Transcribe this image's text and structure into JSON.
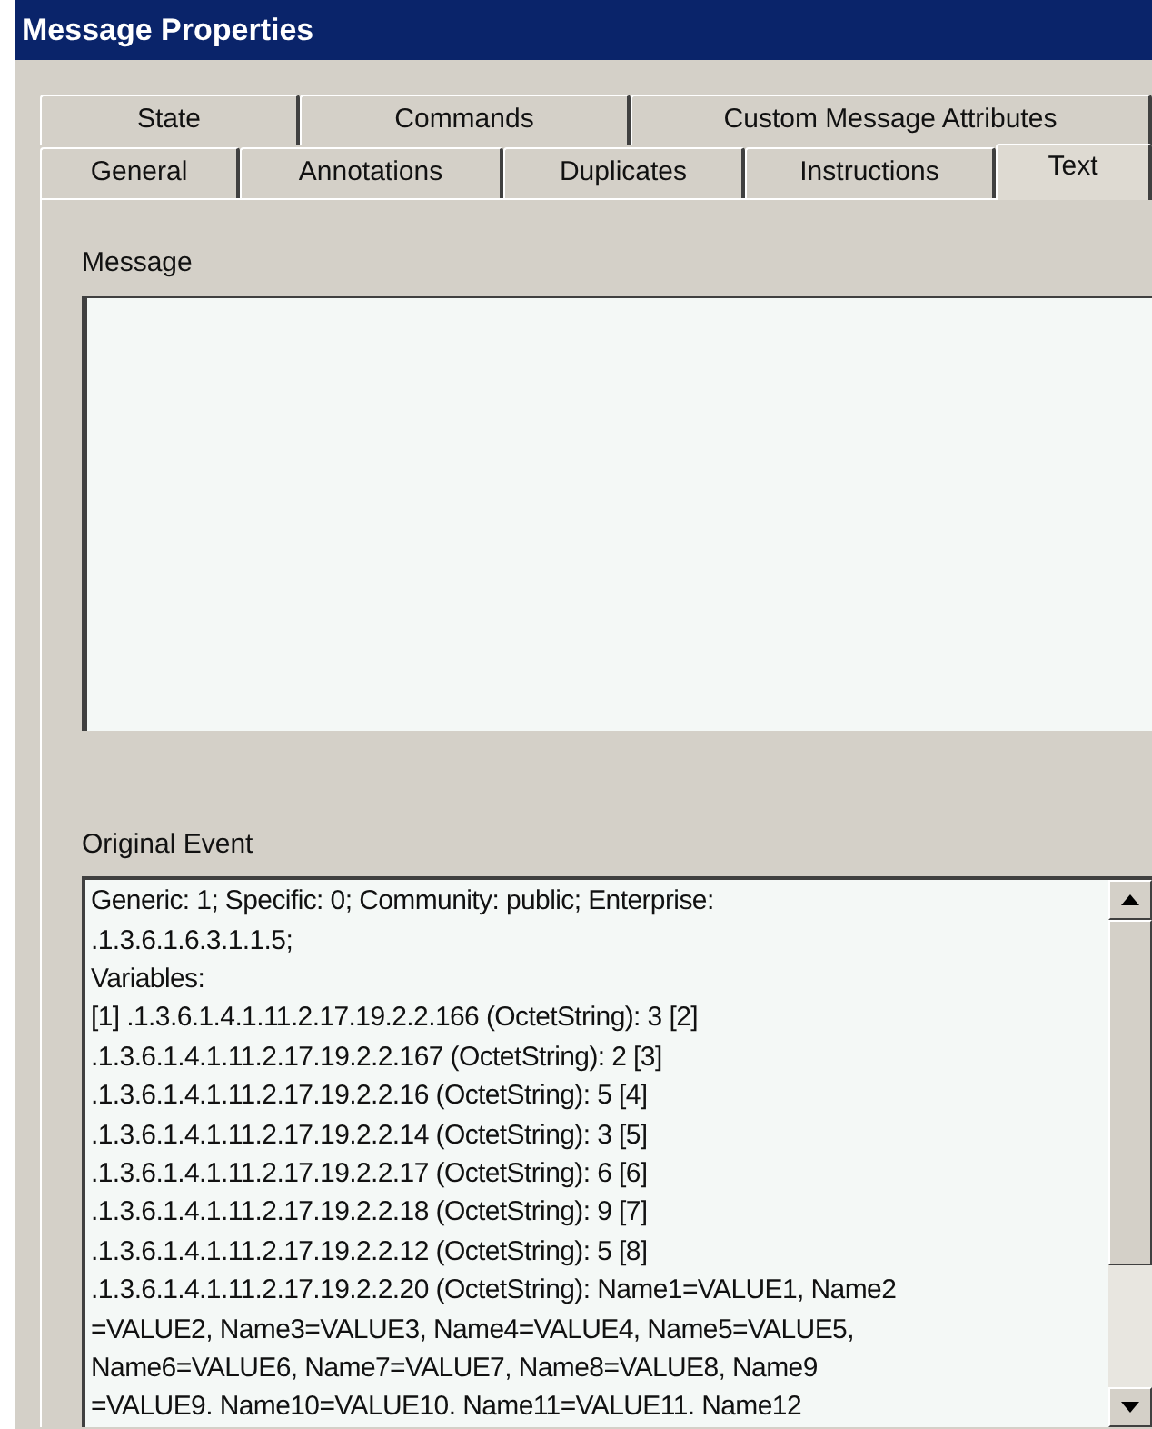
{
  "window": {
    "title": "Message Properties"
  },
  "tab_rows": [
    [
      {
        "label": "State",
        "selected": false
      },
      {
        "label": "Commands",
        "selected": false
      },
      {
        "label": "Custom Message Attributes",
        "selected": false
      }
    ],
    [
      {
        "label": "General",
        "selected": false
      },
      {
        "label": "Annotations",
        "selected": false
      },
      {
        "label": "Duplicates",
        "selected": false
      },
      {
        "label": "Instructions",
        "selected": false
      },
      {
        "label": "Text",
        "selected": true
      }
    ]
  ],
  "message": {
    "label": "Message"
  },
  "original_event": {
    "label": "Original Event",
    "lines": [
      "Generic: 1; Specific: 0; Community: public; Enterprise:",
      ".1.3.6.1.6.3.1.1.5;",
      "Variables:",
      "[1] .1.3.6.1.4.1.11.2.17.19.2.2.166 (OctetString): 3 [2]",
      ".1.3.6.1.4.1.11.2.17.19.2.2.167 (OctetString): 2 [3]",
      ".1.3.6.1.4.1.11.2.17.19.2.2.16 (OctetString): 5 [4]",
      ".1.3.6.1.4.1.11.2.17.19.2.2.14 (OctetString): 3 [5]",
      ".1.3.6.1.4.1.11.2.17.19.2.2.17 (OctetString): 6 [6]",
      ".1.3.6.1.4.1.11.2.17.19.2.2.18 (OctetString): 9 [7]",
      ".1.3.6.1.4.1.11.2.17.19.2.2.12 (OctetString): 5 [8]",
      ".1.3.6.1.4.1.11.2.17.19.2.2.20 (OctetString): Name1=VALUE1, Name2",
      "=VALUE2, Name3=VALUE3, Name4=VALUE4, Name5=VALUE5,",
      "Name6=VALUE6, Name7=VALUE7, Name8=VALUE8, Name9",
      "=VALUE9. Name10=VALUE10. Name11=VALUE11. Name12"
    ]
  }
}
